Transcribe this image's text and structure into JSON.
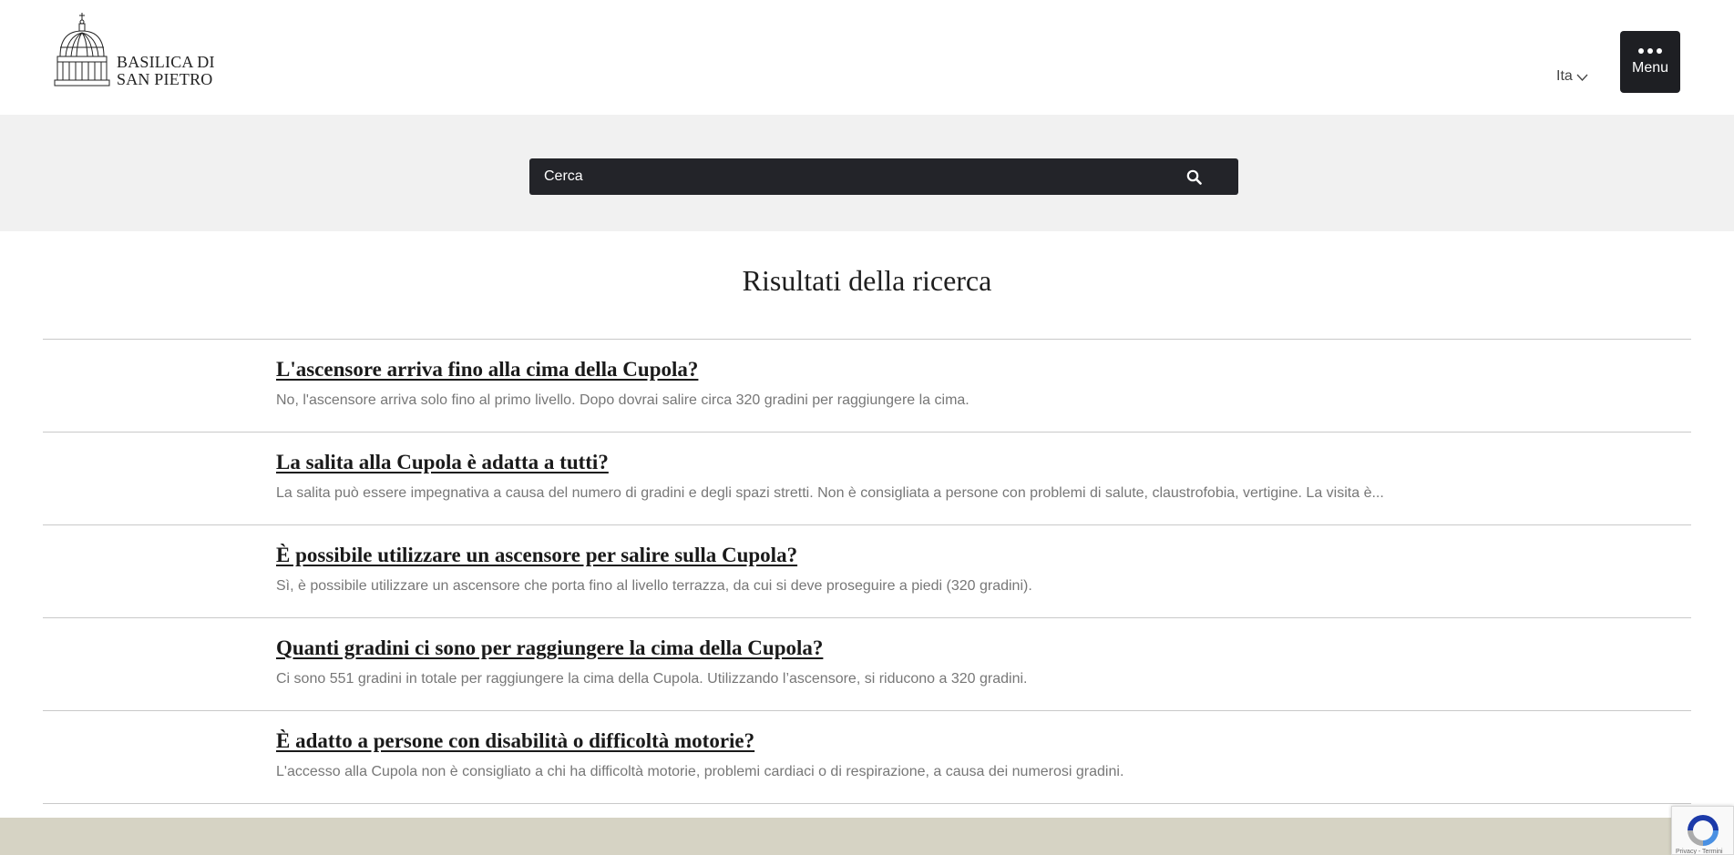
{
  "header": {
    "logo_line1": "BASILICA DI",
    "logo_line2": "SAN PIETRO",
    "language": "Ita",
    "menu_label": "Menu"
  },
  "search": {
    "placeholder": "Cerca"
  },
  "results": {
    "title": "Risultati della ricerca",
    "items": [
      {
        "title": "L'ascensore arriva fino alla cima della Cupola?",
        "text": "No, l'ascensore arriva solo fino al primo livello. Dopo dovrai salire circa 320 gradini per raggiungere la cima."
      },
      {
        "title": "La salita alla Cupola è adatta a tutti?",
        "text": "La salita può essere impegnativa a causa del numero di gradini e degli spazi stretti. Non è consigliata a persone con problemi di salute, claustrofobia, vertigine. La visita è..."
      },
      {
        "title": "È possibile utilizzare un ascensore per salire sulla Cupola?",
        "text": "Sì, è possibile utilizzare un ascensore che porta fino al livello terrazza, da cui si deve proseguire a piedi (320 gradini)."
      },
      {
        "title": "Quanti gradini ci sono per raggiungere la cima della Cupola?",
        "text": "Ci sono 551 gradini in totale per raggiungere la cima della Cupola. Utilizzando l’ascensore, si riducono a 320 gradini."
      },
      {
        "title": "È adatto a persone con disabilità o difficoltà motorie?",
        "text": "L'accesso alla Cupola non è consigliato a chi ha difficoltà motorie, problemi cardiaci o di respirazione, a causa dei numerosi gradini."
      }
    ]
  },
  "recaptcha": {
    "links": "Privacy - Termini"
  },
  "colors": {
    "search_bg": "#232429",
    "menu_bg": "#1e1f23",
    "band_bg": "#f1f1f1",
    "footer_bg": "#d6d3c4"
  },
  "icons": {
    "logo": "basilica-dome-icon",
    "language_toggle": "chevron-down-icon",
    "menu": "dots-icon",
    "search": "search-icon",
    "recaptcha": "recaptcha-icon"
  }
}
